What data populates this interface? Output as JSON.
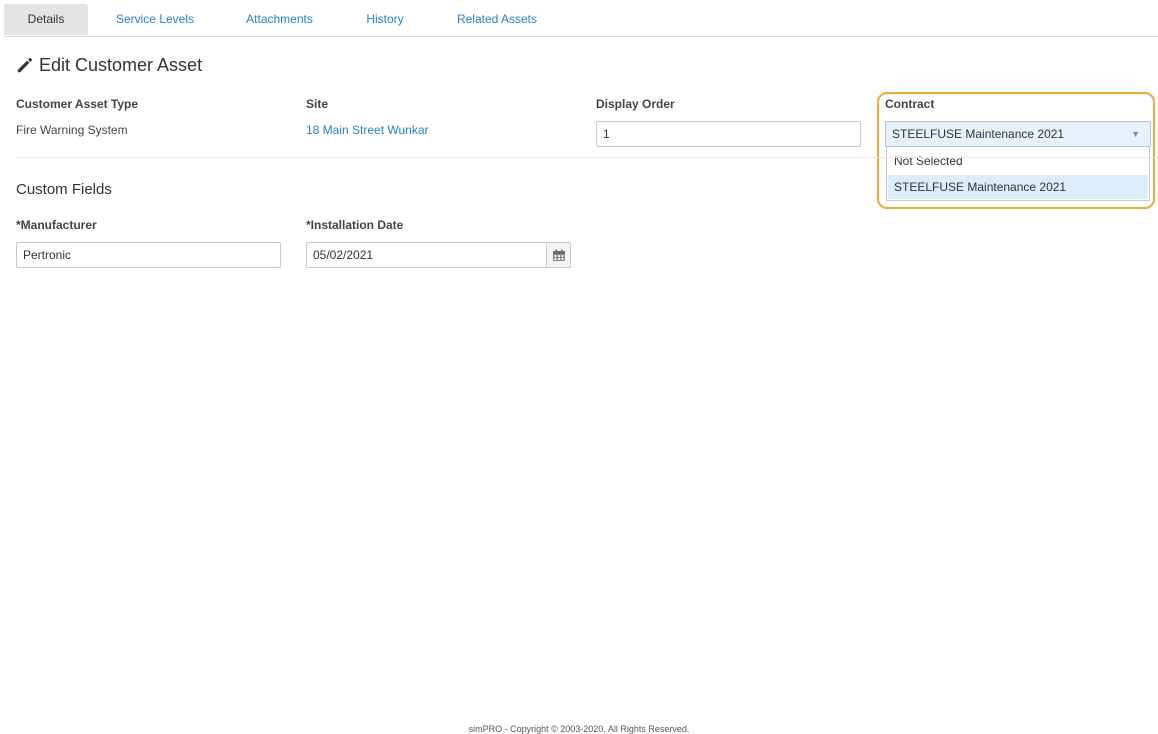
{
  "tabs": [
    {
      "label": "Details",
      "active": true
    },
    {
      "label": "Service Levels",
      "active": false
    },
    {
      "label": "Attachments",
      "active": false
    },
    {
      "label": "History",
      "active": false
    },
    {
      "label": "Related Assets",
      "active": false
    }
  ],
  "page": {
    "title": "Edit Customer Asset",
    "title_icon": "pencil-icon"
  },
  "details": {
    "asset_type_label": "Customer Asset Type",
    "asset_type_value": "Fire Warning System",
    "site_label": "Site",
    "site_value": "18 Main Street Wunkar",
    "display_order_label": "Display Order",
    "display_order_value": "1",
    "contract_label": "Contract",
    "contract_selected": "STEELFUSE Maintenance 2021",
    "contract_options": [
      "Not Selected",
      "STEELFUSE Maintenance 2021"
    ]
  },
  "custom_fields": {
    "title": "Custom Fields",
    "manufacturer_label": "*Manufacturer",
    "manufacturer_value": "Pertronic",
    "installation_date_label": "*Installation Date",
    "installation_date_value": "05/02/2021",
    "calendar_icon": "calendar-icon"
  },
  "colors": {
    "link": "#2a7fc6",
    "highlight": "#f2a93b",
    "selected_option": "#dceefb"
  },
  "footer": {
    "text": "simPRO - Copyright © 2003-2020. All Rights Reserved."
  }
}
